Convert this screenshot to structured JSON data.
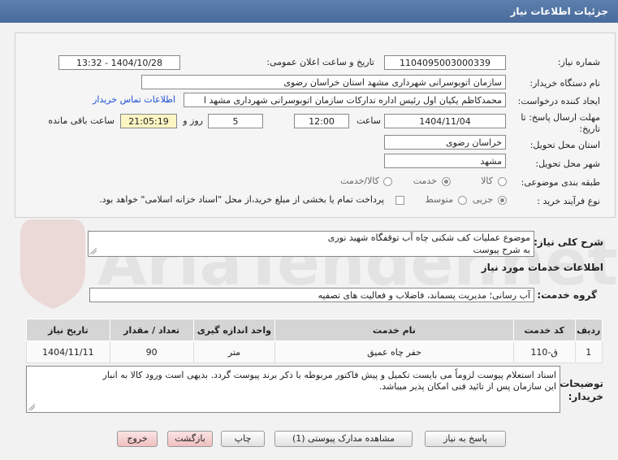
{
  "header": {
    "title": "جزئیات اطلاعات نیاز"
  },
  "form": {
    "need_number_label": "شماره نیاز:",
    "need_number": "1104095003000339",
    "announce_label": "تاریخ و ساعت اعلان عمومی:",
    "announce_value": "1404/10/28 - 13:32",
    "buyer_label": "نام دستگاه خریدار:",
    "buyer_value": "سازمان اتوبوسرانی شهرداری مشهد استان خراسان رضوی",
    "creator_label": "ایجاد کننده درخواست:",
    "creator_value": "محمدکاظم یکیان اول رئیس اداره تدارکات سازمان اتوبوسرانی شهرداری مشهد ا",
    "contact_link": "اطلاعات تماس خریدار",
    "deadline_label_1": "مهلت ارسال پاسخ: تا",
    "deadline_label_2": "تاریخ:",
    "deadline_date": "1404/11/04",
    "time_label": "ساعت",
    "deadline_time": "12:00",
    "days_value": "5",
    "days_label": "روز و",
    "remaining_time": "21:05:19",
    "remaining_label": "ساعت باقی مانده",
    "province_label": "استان محل تحویل:",
    "province_value": "خراسان رضوی",
    "city_label": "شهر محل تحویل:",
    "city_value": "مشهد",
    "category_label": "طبقه بندی موضوعی:",
    "category_options": [
      "کالا",
      "خدمت",
      "کالا/خدمت"
    ],
    "category_selected": "خدمت",
    "purchase_label": "نوع فرآیند خرید :",
    "purchase_options": [
      "جزیی",
      "متوسط"
    ],
    "purchase_selected": "جزیی",
    "treasury_note": "پرداخت تمام یا بخشی از مبلغ خرید،از محل \"اسناد خزانه اسلامی\" خواهد بود."
  },
  "summary": {
    "label": "شرح کلی نیاز:",
    "line1": "موضوع عملیات کف شکنی چاه آب توقفگاه شهید نوری",
    "line2": "به شرح پیوست"
  },
  "services": {
    "section_title": "اطلاعات خدمات مورد نیاز",
    "group_label": "گروه خدمت:",
    "group_value": "آب رسانی؛ مدیریت پسماند، فاضلاب و فعالیت های تصفیه",
    "columns": [
      "ردیف",
      "کد خدمت",
      "نام خدمت",
      "واحد اندازه گیری",
      "تعداد / مقدار",
      "تاریخ نیاز"
    ],
    "rows": [
      {
        "row": "1",
        "code": "ق-110",
        "name": "حفر چاه عمیق",
        "unit": "متر",
        "qty": "90",
        "date": "1404/11/11"
      }
    ]
  },
  "buyer_notes": {
    "label_1": "توضیحات",
    "label_2": "خریدار:",
    "line1": "اسناد استعلام پیوست لزوماً می بایست تکمیل و پیش فاکتور مربوطه با ذکر برند پیوست گردد. بدیهی است ورود کالا به انبار",
    "line2": "این سازمان پس از تائید فنی امکان پذیر میباشد."
  },
  "buttons": {
    "reply": "پاسخ به نیاز",
    "attachments": "مشاهده مدارک پیوستی (1)",
    "print": "چاپ",
    "back": "بازگشت",
    "exit": "خروج"
  },
  "watermark": {
    "text": "AriaTender.net"
  },
  "colors": {
    "header": "#4f72a3",
    "link": "#1a4fd6",
    "highlight": "#fdf5c4",
    "table_head": "#d5d5d5"
  }
}
